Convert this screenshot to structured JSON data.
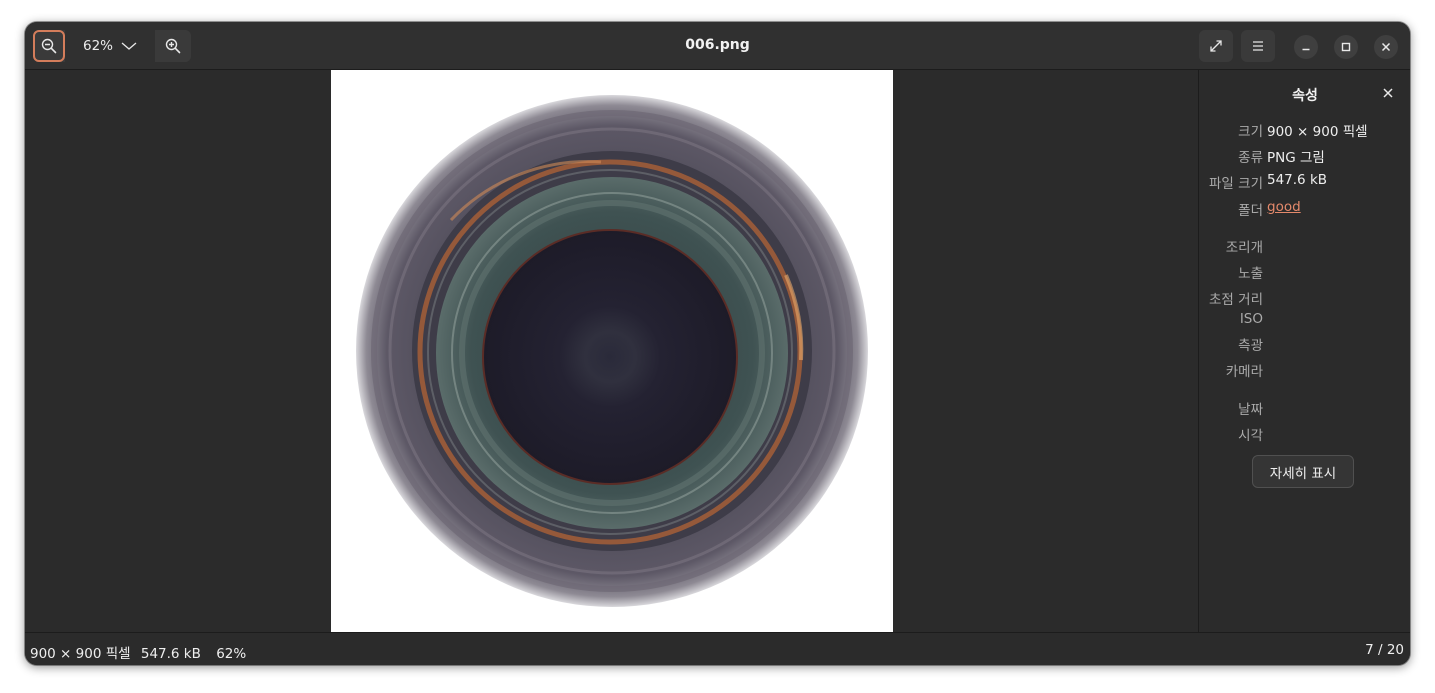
{
  "window": {
    "title": "006.png"
  },
  "toolbar": {
    "zoom_level": "62%",
    "icons": {
      "zoom_out": "zoom-out-icon",
      "zoom_dropdown": "chevron-down-icon",
      "zoom_in": "zoom-in-icon",
      "fullscreen": "fullscreen-icon",
      "menu": "hamburger-menu-icon",
      "minimize": "minimize-icon",
      "maximize": "maximize-icon",
      "close": "close-icon"
    }
  },
  "properties": {
    "title": "속성",
    "rows": {
      "size": {
        "label": "크기",
        "value": "900 × 900 픽셀"
      },
      "type": {
        "label": "종류",
        "value": "PNG 그림"
      },
      "file_size": {
        "label": "파일 크기",
        "value": "547.6 kB"
      },
      "folder": {
        "label": "폴더",
        "value": "good"
      },
      "aperture": {
        "label": "조리개"
      },
      "exposure": {
        "label": "노출"
      },
      "focal_length": {
        "label": "초점 거리"
      },
      "iso": {
        "label": "ISO"
      },
      "metering": {
        "label": "측광"
      },
      "camera": {
        "label": "카메라"
      },
      "date": {
        "label": "날짜"
      },
      "time": {
        "label": "시각"
      }
    },
    "details_button": "자세히 표시"
  },
  "statusbar": {
    "dimensions": "900 × 900 픽셀",
    "file_size": "547.6 kB",
    "zoom": "62%",
    "position": "7 / 20"
  },
  "colors": {
    "accent": "#d47d5b",
    "link": "#e4896b",
    "window_bg": "#2b2b2b",
    "headerbar_bg": "#303030"
  }
}
